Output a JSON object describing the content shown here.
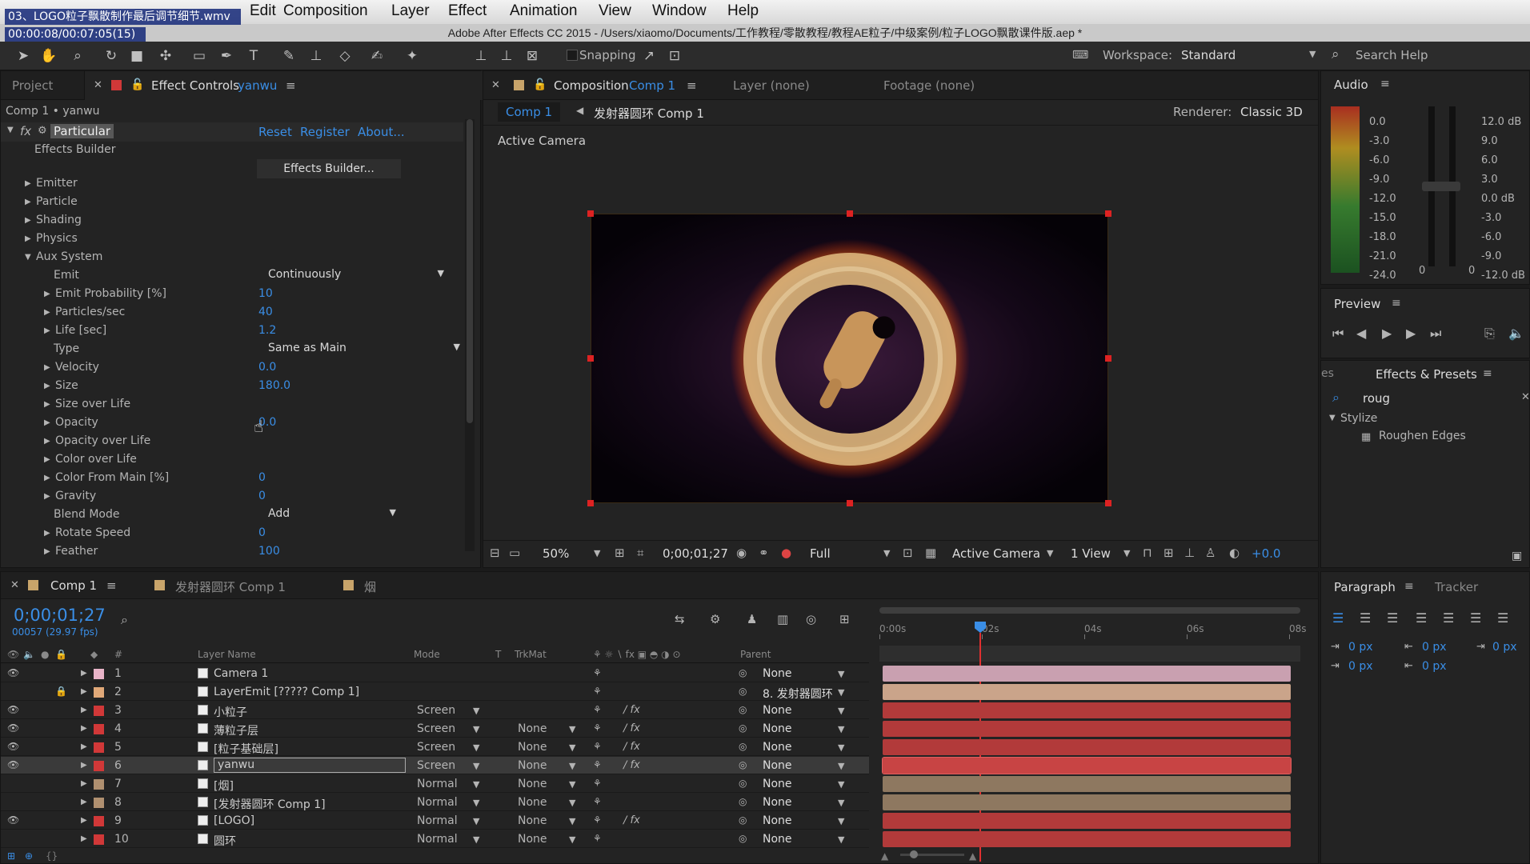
{
  "overlay": {
    "file": "03、LOGO粒子飘散制作最后调节细节.wmv",
    "time": "00:00:08/00:07:05(15)"
  },
  "menu": [
    "Edit",
    "Composition",
    "Layer",
    "Effect",
    "Animation",
    "View",
    "Window",
    "Help"
  ],
  "title": "Adobe After Effects CC 2015 - /Users/xiaomo/Documents/工作教程/零散教程/教程AE粒子/中级案例/粒子LOGO飘散课件版.aep *",
  "toolbar": {
    "snapping": "Snapping",
    "workspace_label": "Workspace:",
    "workspace": "Standard",
    "search": "Search Help"
  },
  "left_panel": {
    "tab_project": "Project",
    "tab_effect": "Effect Controls",
    "tab_effect_layer": "yanwu",
    "breadcrumb": "Comp 1 • yanwu",
    "effect": "Particular",
    "reset": "Reset",
    "register": "Register",
    "about": "About...",
    "builder_label": "Effects Builder",
    "builder_btn": "Effects Builder...",
    "groups": [
      "Emitter",
      "Particle",
      "Shading",
      "Physics"
    ],
    "aux": "Aux System",
    "props": [
      {
        "name": "Emit",
        "type": "dd",
        "value": "Continuously"
      },
      {
        "name": "Emit Probability [%]",
        "value": "10"
      },
      {
        "name": "Particles/sec",
        "value": "40"
      },
      {
        "name": "Life [sec]",
        "value": "1.2"
      },
      {
        "name": "Type",
        "type": "dd",
        "value": "Same as Main"
      },
      {
        "name": "Velocity",
        "value": "0.0"
      },
      {
        "name": "Size",
        "value": "180.0"
      },
      {
        "name": "Size over Life",
        "value": ""
      },
      {
        "name": "Opacity",
        "value": "0.0"
      },
      {
        "name": "Opacity over Life",
        "value": ""
      },
      {
        "name": "Color over Life",
        "value": ""
      },
      {
        "name": "Color From Main [%]",
        "value": "0"
      },
      {
        "name": "Gravity",
        "value": "0"
      },
      {
        "name": "Blend Mode",
        "type": "dd",
        "value": "Add"
      },
      {
        "name": "Rotate Speed",
        "value": "0"
      },
      {
        "name": "Feather",
        "value": "100"
      }
    ]
  },
  "comp_panel": {
    "tab_comp": "Composition",
    "tab_comp_name": "Comp 1",
    "tab_layer": "Layer (none)",
    "tab_footage": "Footage (none)",
    "crumb1": "Comp 1",
    "crumb2": "发射器圆环 Comp 1",
    "renderer_label": "Renderer:",
    "renderer": "Classic 3D",
    "active_camera": "Active Camera",
    "footer": {
      "zoom": "50%",
      "timecode": "0;00;01;27",
      "quality": "Full",
      "view": "Active Camera",
      "views": "1 View",
      "exposure": "+0.0"
    }
  },
  "audio": {
    "title": "Audio",
    "left": [
      "0.0",
      "-3.0",
      "-6.0",
      "-9.0",
      "-12.0",
      "-15.0",
      "-18.0",
      "-21.0",
      "-24.0"
    ],
    "right": [
      "12.0 dB",
      "9.0",
      "6.0",
      "3.0",
      "0.0 dB",
      "-3.0",
      "-6.0",
      "-9.0",
      "-12.0 dB"
    ],
    "zero1": "0",
    "zero2": "0"
  },
  "preview": {
    "title": "Preview"
  },
  "effects_presets": {
    "title": "Effects & Presets",
    "prev_tab": "es",
    "search": "roug",
    "category": "Stylize",
    "item": "Roughen Edges"
  },
  "paragraph": {
    "title": "Paragraph",
    "tracker": "Tracker",
    "v1": "0 px",
    "v2": "0 px",
    "v3": "0 px",
    "v4": "0 px",
    "v5": "0 px"
  },
  "timeline": {
    "tab1": "Comp 1",
    "tab2": "发射器圆环 Comp 1",
    "tab3": "烟",
    "timecode": "0;00;01;27",
    "frames": "00057 (29.97 fps)",
    "headers": {
      "num": "#",
      "name": "Layer Name",
      "mode": "Mode",
      "t": "T",
      "trkmat": "TrkMat",
      "parent": "Parent"
    },
    "ruler": [
      "0:00s",
      "02s",
      "04s",
      "06s",
      "08s"
    ],
    "layers": [
      {
        "n": "1",
        "name": "Camera 1",
        "mode": "",
        "trk": "",
        "parent": "None",
        "color": "#e8b4c8",
        "bar": "#c9a0b0"
      },
      {
        "n": "2",
        "name": "LayerEmit [????? Comp 1]",
        "mode": "",
        "trk": "",
        "parent": "8. 发射器圆环",
        "color": "#e0a878",
        "bar": "#caa48a"
      },
      {
        "n": "3",
        "name": "小粒子",
        "mode": "Screen",
        "trk": "",
        "parent": "None",
        "color": "#d13838",
        "bar": "#b23a3a"
      },
      {
        "n": "4",
        "name": "薄粒子层",
        "mode": "Screen",
        "trk": "None",
        "parent": "None",
        "color": "#d13838",
        "bar": "#b23a3a"
      },
      {
        "n": "5",
        "name": "[粒子基础层]",
        "mode": "Screen",
        "trk": "None",
        "parent": "None",
        "color": "#d13838",
        "bar": "#b23a3a"
      },
      {
        "n": "6",
        "name": "yanwu",
        "mode": "Screen",
        "trk": "None",
        "parent": "None",
        "color": "#d13838",
        "bar": "#c84444"
      },
      {
        "n": "7",
        "name": "[烟]",
        "mode": "Normal",
        "trk": "None",
        "parent": "None",
        "color": "#b09070",
        "bar": "#8e7860"
      },
      {
        "n": "8",
        "name": "[发射器圆环 Comp 1]",
        "mode": "Normal",
        "trk": "None",
        "parent": "None",
        "color": "#b09070",
        "bar": "#8e7860"
      },
      {
        "n": "9",
        "name": "[LOGO]",
        "mode": "Normal",
        "trk": "None",
        "parent": "None",
        "color": "#d13838",
        "bar": "#b23a3a"
      },
      {
        "n": "10",
        "name": "圆环",
        "mode": "Normal",
        "trk": "None",
        "parent": "None",
        "color": "#d13838",
        "bar": "#b23a3a"
      }
    ]
  }
}
